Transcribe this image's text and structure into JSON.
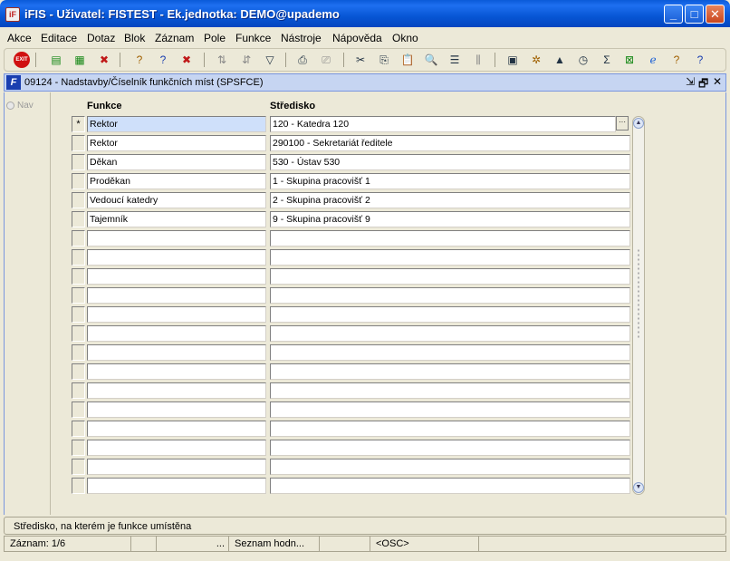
{
  "window": {
    "title": "iFIS - Uživatel: FISTEST - Ek.jednotka: DEMO@upademo",
    "app_icon_glyph": "iF",
    "min_glyph": "_",
    "max_glyph": "□",
    "close_glyph": "✕"
  },
  "menu": [
    "Akce",
    "Editace",
    "Dotaz",
    "Blok",
    "Záznam",
    "Pole",
    "Funkce",
    "Nástroje",
    "Nápověda",
    "Okno"
  ],
  "toolbar": {
    "exit_label": "EXIT"
  },
  "form": {
    "title": "09124 - Nadstavby/Číselník funkčních míst (SPSFCE)",
    "icon_glyph": "F",
    "controls": [
      "⇲",
      "🗗",
      "✕"
    ],
    "nav_label": "Nav"
  },
  "table": {
    "col_funkce": "Funkce",
    "col_stredisko": "Středisko",
    "current_marker": "*",
    "rows": [
      {
        "funkce": "Rektor",
        "stredisko": "120 - Katedra 120"
      },
      {
        "funkce": "Rektor",
        "stredisko": "290100 - Sekretariát ředitele"
      },
      {
        "funkce": "Děkan",
        "stredisko": "530 - Ústav 530"
      },
      {
        "funkce": "Proděkan",
        "stredisko": "1 - Skupina pracovišť 1"
      },
      {
        "funkce": "Vedoucí katedry",
        "stredisko": "2 - Skupina pracovišť 2"
      },
      {
        "funkce": "Tajemník",
        "stredisko": "9 - Skupina pracovišť 9"
      },
      {
        "funkce": "",
        "stredisko": ""
      },
      {
        "funkce": "",
        "stredisko": ""
      },
      {
        "funkce": "",
        "stredisko": ""
      },
      {
        "funkce": "",
        "stredisko": ""
      },
      {
        "funkce": "",
        "stredisko": ""
      },
      {
        "funkce": "",
        "stredisko": ""
      },
      {
        "funkce": "",
        "stredisko": ""
      },
      {
        "funkce": "",
        "stredisko": ""
      },
      {
        "funkce": "",
        "stredisko": ""
      },
      {
        "funkce": "",
        "stredisko": ""
      },
      {
        "funkce": "",
        "stredisko": ""
      },
      {
        "funkce": "",
        "stredisko": ""
      },
      {
        "funkce": "",
        "stredisko": ""
      },
      {
        "funkce": "",
        "stredisko": ""
      }
    ],
    "lov_glyph": "···"
  },
  "status": {
    "hint": "Středisko, na kterém je funkce umístěna",
    "record": "Záznam: 1/6",
    "ellipsis": "...",
    "list": "Seznam hodn...",
    "osc": "<OSC>"
  }
}
